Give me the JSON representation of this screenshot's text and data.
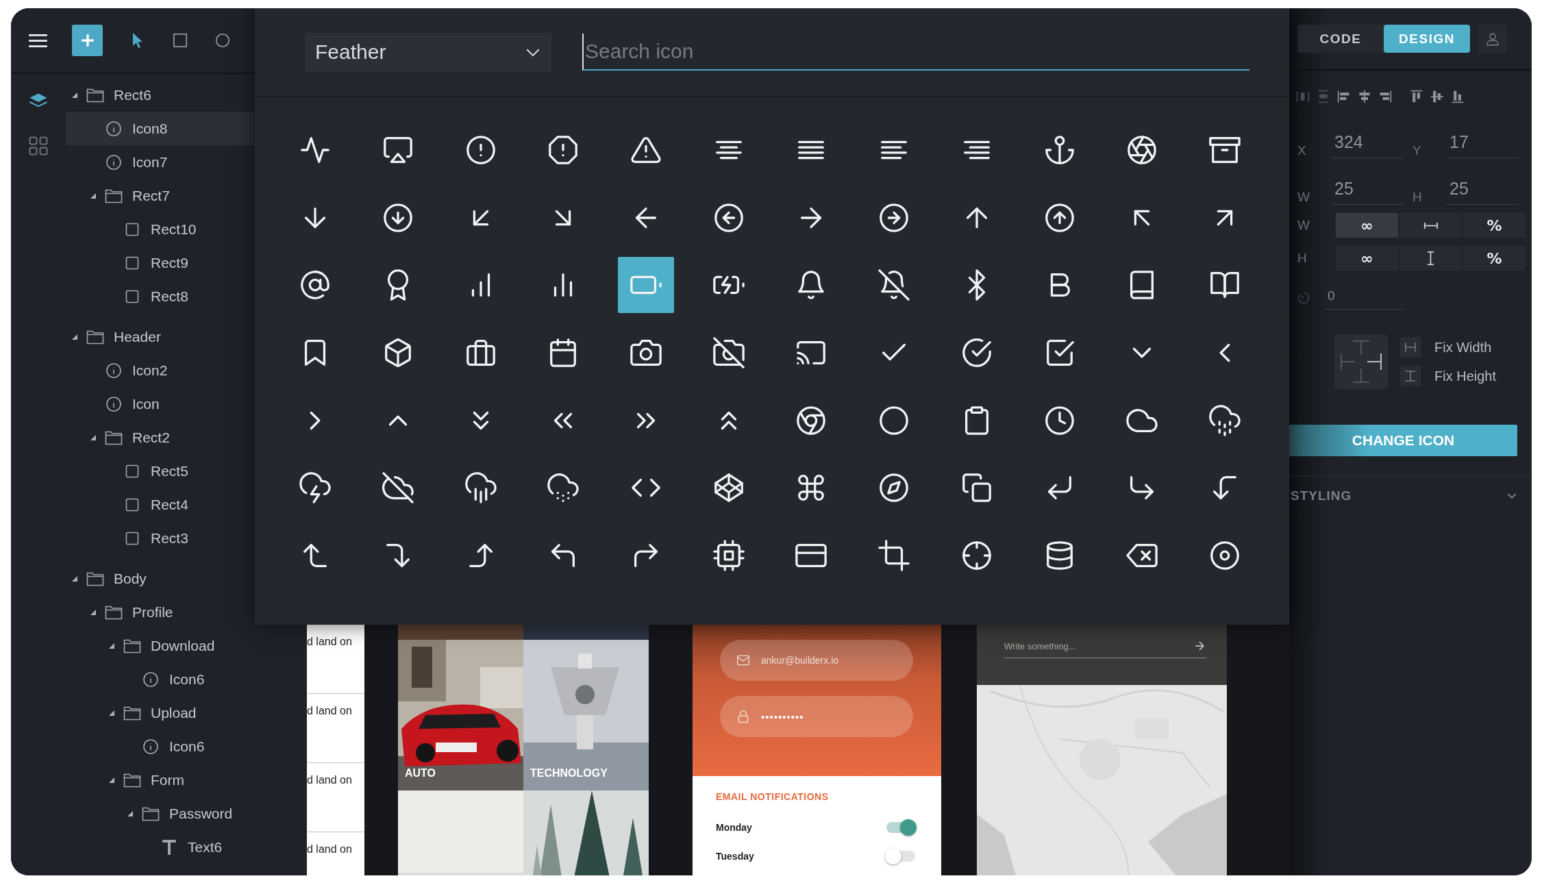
{
  "toolbar": {
    "tools": [
      {
        "kind": "pointer",
        "selected": true
      },
      {
        "kind": "rectangle",
        "selected": false
      },
      {
        "kind": "ellipse",
        "selected": false
      }
    ]
  },
  "rail": [
    {
      "kind": "layers",
      "selected": true
    },
    {
      "kind": "components",
      "selected": false
    }
  ],
  "layers": [
    {
      "kind": "folder",
      "name": "Rect6",
      "expanded": true,
      "selected": false,
      "children": [
        {
          "kind": "icon",
          "name": "Icon8",
          "selected": true
        },
        {
          "kind": "icon",
          "name": "Icon7",
          "selected": false
        },
        {
          "kind": "folder",
          "name": "Rect7",
          "expanded": true,
          "selected": false,
          "children": [
            {
              "kind": "rect",
              "name": "Rect10",
              "selected": false
            },
            {
              "kind": "rect",
              "name": "Rect9",
              "selected": false
            },
            {
              "kind": "rect",
              "name": "Rect8",
              "selected": false
            }
          ]
        }
      ]
    },
    {
      "kind": "folder",
      "name": "Header",
      "expanded": true,
      "selected": false,
      "children": [
        {
          "kind": "icon",
          "name": "Icon2",
          "selected": false
        },
        {
          "kind": "icon",
          "name": "Icon",
          "selected": false
        },
        {
          "kind": "folder",
          "name": "Rect2",
          "expanded": true,
          "selected": false,
          "children": [
            {
              "kind": "rect",
              "name": "Rect5",
              "selected": false
            },
            {
              "kind": "rect",
              "name": "Rect4",
              "selected": false
            },
            {
              "kind": "rect",
              "name": "Rect3",
              "selected": false
            }
          ]
        }
      ]
    },
    {
      "kind": "folder",
      "name": "Body",
      "expanded": true,
      "selected": false,
      "children": [
        {
          "kind": "folder",
          "name": "Profile",
          "expanded": true,
          "selected": false,
          "children": [
            {
              "kind": "folder",
              "name": "Download",
              "expanded": true,
              "selected": false,
              "children": [
                {
                  "kind": "icon",
                  "name": "Icon6",
                  "selected": false
                }
              ]
            },
            {
              "kind": "folder",
              "name": "Upload",
              "expanded": true,
              "selected": false,
              "children": [
                {
                  "kind": "icon",
                  "name": "Icon6",
                  "selected": false
                }
              ]
            },
            {
              "kind": "folder",
              "name": "Form",
              "expanded": true,
              "selected": false,
              "children": [
                {
                  "kind": "folder",
                  "name": "Password",
                  "expanded": true,
                  "selected": false,
                  "children": [
                    {
                      "kind": "text",
                      "name": "Text6",
                      "selected": false
                    }
                  ]
                }
              ]
            }
          ]
        }
      ]
    }
  ],
  "icon_picker": {
    "library": "Feather",
    "search": {
      "placeholder": "Search icon"
    },
    "icons": [
      {
        "selected": false
      },
      {
        "selected": false
      },
      {
        "selected": false
      },
      {
        "selected": false
      },
      {
        "selected": false
      },
      {
        "selected": false
      },
      {
        "selected": false
      },
      {
        "selected": false
      },
      {
        "selected": false
      },
      {
        "selected": false
      },
      {
        "selected": false
      },
      {
        "selected": false
      },
      {
        "selected": false
      },
      {
        "selected": false
      },
      {
        "selected": false
      },
      {
        "selected": false
      },
      {
        "selected": false
      },
      {
        "selected": false
      },
      {
        "selected": false
      },
      {
        "selected": false
      },
      {
        "selected": false
      },
      {
        "selected": false
      },
      {
        "selected": false
      },
      {
        "selected": false
      },
      {
        "selected": false
      },
      {
        "selected": false
      },
      {
        "selected": false
      },
      {
        "selected": false
      },
      {
        "selected": true
      },
      {
        "selected": false
      },
      {
        "selected": false
      },
      {
        "selected": false
      },
      {
        "selected": false
      },
      {
        "selected": false
      },
      {
        "selected": false
      },
      {
        "selected": false
      },
      {
        "selected": false
      },
      {
        "selected": false
      },
      {
        "selected": false
      },
      {
        "selected": false
      },
      {
        "selected": false
      },
      {
        "selected": false
      },
      {
        "selected": false
      },
      {
        "selected": false
      },
      {
        "selected": false
      },
      {
        "selected": false
      },
      {
        "selected": false
      },
      {
        "selected": false
      },
      {
        "selected": false
      },
      {
        "selected": false
      },
      {
        "selected": false
      },
      {
        "selected": false
      },
      {
        "selected": false
      },
      {
        "selected": false
      },
      {
        "selected": false
      },
      {
        "selected": false
      },
      {
        "selected": false
      },
      {
        "selected": false
      },
      {
        "selected": false
      },
      {
        "selected": false
      },
      {
        "selected": false
      },
      {
        "selected": false
      },
      {
        "selected": false
      },
      {
        "selected": false
      },
      {
        "selected": false
      },
      {
        "selected": false
      },
      {
        "selected": false
      },
      {
        "selected": false
      },
      {
        "selected": false
      },
      {
        "selected": false
      },
      {
        "selected": false
      },
      {
        "selected": false
      },
      {
        "selected": false
      },
      {
        "selected": false
      },
      {
        "selected": false
      },
      {
        "selected": false
      },
      {
        "selected": false
      },
      {
        "selected": false
      },
      {
        "selected": false
      },
      {
        "selected": false
      },
      {
        "selected": false
      },
      {
        "selected": false
      },
      {
        "selected": false
      },
      {
        "selected": false
      }
    ]
  },
  "mode_tabs": [
    {
      "label": "CODE",
      "selected": false
    },
    {
      "label": "DESIGN",
      "selected": true
    }
  ],
  "fields": [
    {
      "label": "X",
      "value": "324"
    },
    {
      "label": "Y",
      "value": "17"
    },
    {
      "label": "W",
      "value": "25"
    },
    {
      "label": "H",
      "value": "25"
    }
  ],
  "sizing": [
    {
      "label": "W",
      "options": [
        {
          "kind": "text",
          "text": "∞",
          "selected": true
        },
        {
          "kind": "span_h",
          "selected": false
        },
        {
          "kind": "text",
          "text": "%",
          "selected": false
        }
      ]
    },
    {
      "label": "H",
      "options": [
        {
          "kind": "text",
          "text": "∞",
          "selected": false
        },
        {
          "kind": "span_v",
          "selected": false
        },
        {
          "kind": "text",
          "text": "%",
          "selected": false
        }
      ]
    }
  ],
  "rotation": {
    "value": "0"
  },
  "constraints": [
    {
      "kind": "width",
      "label": "Fix Width"
    },
    {
      "kind": "height",
      "label": "Fix Height"
    }
  ],
  "change_icon_button": "CHANGE ICON",
  "styling": {
    "label": "STYLING",
    "expanded": false
  },
  "canvas": {
    "list_card": {
      "rows": [
        "d land on",
        "d land on",
        "d land on",
        "d land on"
      ]
    },
    "photo_grid": {
      "tiles": [
        {
          "kind": "picture",
          "caption": "AUTO"
        },
        {
          "kind": "picture",
          "caption": "TECHNOLOGY"
        },
        {
          "kind": "picture"
        },
        {
          "kind": "picture"
        }
      ]
    },
    "login_card": {
      "email": "ankur@builderx.io",
      "password": "••••••••••",
      "section_title": "EMAIL NOTIFICATIONS",
      "days": [
        {
          "label": "Monday",
          "on": true
        },
        {
          "label": "Tuesday",
          "on": false
        }
      ]
    },
    "map_card": {
      "message": {
        "placeholder": "Write something..."
      }
    }
  }
}
